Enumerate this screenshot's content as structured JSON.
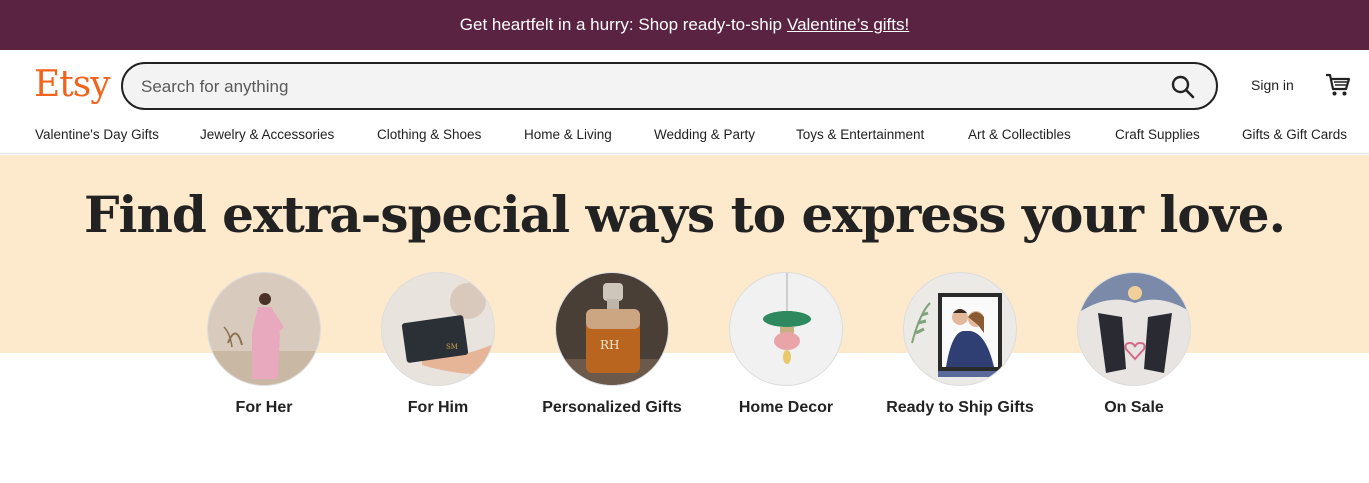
{
  "promo": {
    "text": "Get heartfelt in a hurry: Shop ready-to-ship",
    "link": "Valentine’s gifts!"
  },
  "header": {
    "logo": "Etsy",
    "search_placeholder": "Search for anything",
    "signin": "Sign in"
  },
  "categories": [
    "Valentine's Day Gifts",
    "Jewelry & Accessories",
    "Clothing & Shoes",
    "Home & Living",
    "Wedding & Party",
    "Toys & Entertainment",
    "Art & Collectibles",
    "Craft Supplies",
    "Gifts & Gift Cards"
  ],
  "hero": {
    "headline": "Find extra-special ways to express your love."
  },
  "tiles": [
    {
      "label": "For Her"
    },
    {
      "label": "For Him"
    },
    {
      "label": "Personalized Gifts"
    },
    {
      "label": "Home Decor"
    },
    {
      "label": "Ready to Ship Gifts"
    },
    {
      "label": "On Sale"
    }
  ],
  "colors": {
    "promo_bg": "#5b2342",
    "brand": "#f1641e",
    "hero_bg": "#fde9cc"
  }
}
